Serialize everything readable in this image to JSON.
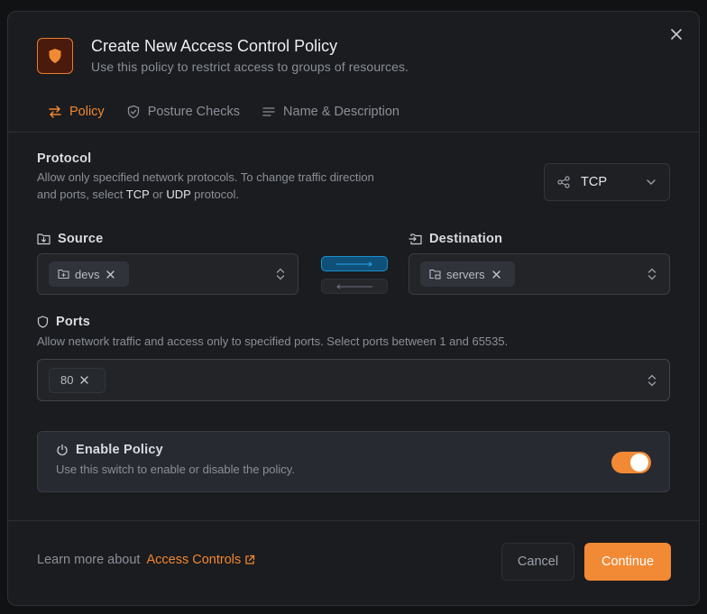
{
  "dialog": {
    "title": "Create New Access Control Policy",
    "subtitle": "Use this policy to restrict access to groups of resources.",
    "header_icon": "shield-icon",
    "close_icon": "close-icon"
  },
  "tabs": [
    {
      "label": "Policy",
      "icon": "arrows-left-right-icon",
      "active": true
    },
    {
      "label": "Posture Checks",
      "icon": "shield-check-icon",
      "active": false
    },
    {
      "label": "Name & Description",
      "icon": "text-lines-icon",
      "active": false
    }
  ],
  "protocol": {
    "label": "Protocol",
    "description_part1": "Allow only specified network protocols. To change traffic direction and ports, select ",
    "tcp": "TCP",
    "or": " or ",
    "udp": "UDP",
    "description_part2": " protocol.",
    "selected": "TCP",
    "icon": "share-nodes-icon"
  },
  "source": {
    "label": "Source",
    "icon": "folder-down-icon",
    "chips": [
      {
        "label": "devs",
        "icon": "folder-plus-icon"
      }
    ]
  },
  "destination": {
    "label": "Destination",
    "icon": "folder-in-icon",
    "chips": [
      {
        "label": "servers",
        "icon": "folder-server-icon"
      }
    ]
  },
  "direction": {
    "forward_active": true,
    "backward_active": false
  },
  "ports": {
    "label": "Ports",
    "icon": "shield-outline-icon",
    "description": "Allow network traffic and access only to specified ports. Select ports between 1 and 65535.",
    "values": [
      "80"
    ]
  },
  "enable_policy": {
    "label": "Enable Policy",
    "description": "Use this switch to enable or disable the policy.",
    "enabled": true,
    "icon": "power-icon"
  },
  "footer": {
    "learn_prefix": "Learn more about",
    "learn_link": "Access Controls",
    "cancel_label": "Cancel",
    "continue_label": "Continue"
  },
  "colors": {
    "accent": "#f28a35",
    "direction_active": "#1a8fd0",
    "background": "#1b1c1f"
  }
}
